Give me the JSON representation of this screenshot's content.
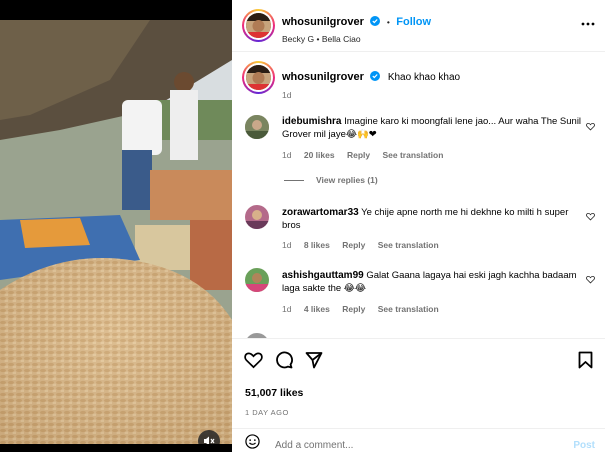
{
  "colors": {
    "accent": "#0095f6",
    "muted": "#737373",
    "heart": "#ed4956"
  },
  "media": {
    "type": "video",
    "description_icon": "muted-speaker-icon"
  },
  "header": {
    "username": "whosunilgrover",
    "follow_label": "Follow",
    "separator": "•",
    "audio": "Becky G • Bella Ciao",
    "more_icon": "more-horizontal-icon"
  },
  "caption": {
    "username": "whosunilgrover",
    "text": "Khao khao khao",
    "time": "1d"
  },
  "comments": [
    {
      "username": "idebumishra",
      "text": "Imagine karo ki moongfali lene jao... Aur waha The Sunil Grover mil jaye😂🙌❤",
      "time": "1d",
      "likes": "20 likes",
      "reply": "Reply",
      "translate": "See translation",
      "view_replies": "View replies (1)"
    },
    {
      "username": "zorawartomar33",
      "text": "Ye chije apne north me hi dekhne ko milti h super bros",
      "time": "1d",
      "likes": "8 likes",
      "reply": "Reply",
      "translate": "See translation"
    },
    {
      "username": "ashishgauttam99",
      "text": "Galat Gaana lagaya hai eski jagh kachha badaam laga sakte the 😂😂",
      "time": "1d",
      "likes": "4 likes",
      "reply": "Reply",
      "translate": "See translation"
    }
  ],
  "footer": {
    "likes": "51,007 likes",
    "date": "1 DAY AGO",
    "comment_placeholder": "Add a comment...",
    "post_label": "Post"
  }
}
